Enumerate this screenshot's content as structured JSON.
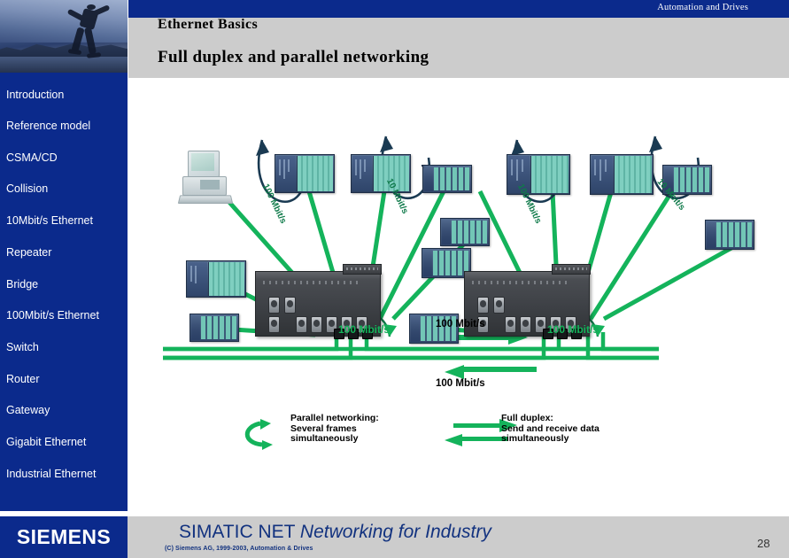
{
  "header": {
    "org": "Automation and Drives",
    "title": "Ethernet Basics",
    "subtitle": "Full duplex and parallel networking"
  },
  "sidebar": {
    "items": [
      {
        "label": "Introduction"
      },
      {
        "label": "Reference model"
      },
      {
        "label": "CSMA/CD"
      },
      {
        "label": "Collision"
      },
      {
        "label": "10Mbit/s Ethernet"
      },
      {
        "label": "Repeater"
      },
      {
        "label": "Bridge"
      },
      {
        "label": "100Mbit/s Ethernet"
      },
      {
        "label": "Switch"
      },
      {
        "label": "Router"
      },
      {
        "label": "Gateway"
      },
      {
        "label": "Gigabit Ethernet"
      },
      {
        "label": "Industrial Ethernet"
      }
    ]
  },
  "diagram": {
    "speed_left_top": "100 Mbit/s",
    "speed_left_right": "10 Mbit/s",
    "speed_right_top": "100 Mbit/s",
    "speed_right_right": "10 Mbit/s",
    "switch_left_label": "100 Mbit/s",
    "switch_right_label": "100 Mbit/s",
    "trunk_top_label": "100 Mbit/s",
    "trunk_bottom_label": "100 Mbit/s"
  },
  "legend": {
    "parallel": {
      "line1": "Parallel networking:",
      "line2": "Several frames",
      "line3": "simultaneously"
    },
    "duplex": {
      "line1": "Full duplex:",
      "line2": "Send and receive data",
      "line3": "simultaneously"
    }
  },
  "footer": {
    "logo": "SIEMENS",
    "title_regular": "SIMATIC NET ",
    "title_italic": "Networking for Industry",
    "copyright": "(C) Siemens AG, 1999-2003, Automation & Drives",
    "page": "28"
  },
  "colors": {
    "brand_blue": "#0b2a8c",
    "band_gray": "#cccccc",
    "link_green": "#14b35b",
    "arc_dark": "#1a3a52",
    "footer_text": "#12327f"
  }
}
